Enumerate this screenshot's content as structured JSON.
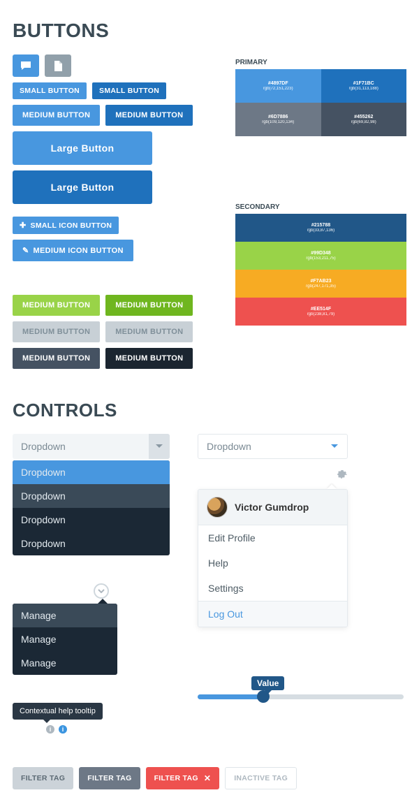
{
  "headings": {
    "buttons": "BUTTONS",
    "controls": "CONTROLS"
  },
  "buttons": {
    "small": "SMALL BUTTON",
    "medium": "MEDIUM BUTTON",
    "large": "Large Button",
    "small_icon": "SMALL ICON BUTTON",
    "medium_icon": "MEDIUM ICON BUTTON"
  },
  "palette": {
    "primary_label": "PRIMARY",
    "secondary_label": "SECONDARY",
    "primary": [
      {
        "hex": "#4897DF",
        "rgb": "rgb(72,151,223)"
      },
      {
        "hex": "#1F71BC",
        "rgb": "rgb(31,113,188)"
      },
      {
        "hex": "#6D7886",
        "rgb": "rgb(109,120,134)"
      },
      {
        "hex": "#455262",
        "rgb": "rgb(69,82,98)"
      }
    ],
    "secondary": [
      {
        "hex": "#215788",
        "rgb": "rgb(33,87,136)"
      },
      {
        "hex": "#99D348",
        "rgb": "rgb(153,211,75)"
      },
      {
        "hex": "#F7AB23",
        "rgb": "rgb(247,171,35)"
      },
      {
        "hex": "#EE514F",
        "rgb": "rgb(238,81,79)"
      }
    ]
  },
  "controls": {
    "dropdown_label": "Dropdown",
    "dropdown_items": [
      "Dropdown",
      "Dropdown",
      "Dropdown",
      "Dropdown"
    ],
    "manage_items": [
      "Manage",
      "Manage",
      "Manage"
    ],
    "user": {
      "name": "Victor Gumdrop",
      "menu": {
        "edit": "Edit Profile",
        "help": "Help",
        "settings": "Settings",
        "logout": "Log Out"
      }
    },
    "slider": {
      "badge": "Value",
      "percent": 32
    },
    "tooltip": "Contextual help tooltip"
  },
  "tags": {
    "filter": "FILTER TAG",
    "inactive": "INACTIVE TAG"
  }
}
